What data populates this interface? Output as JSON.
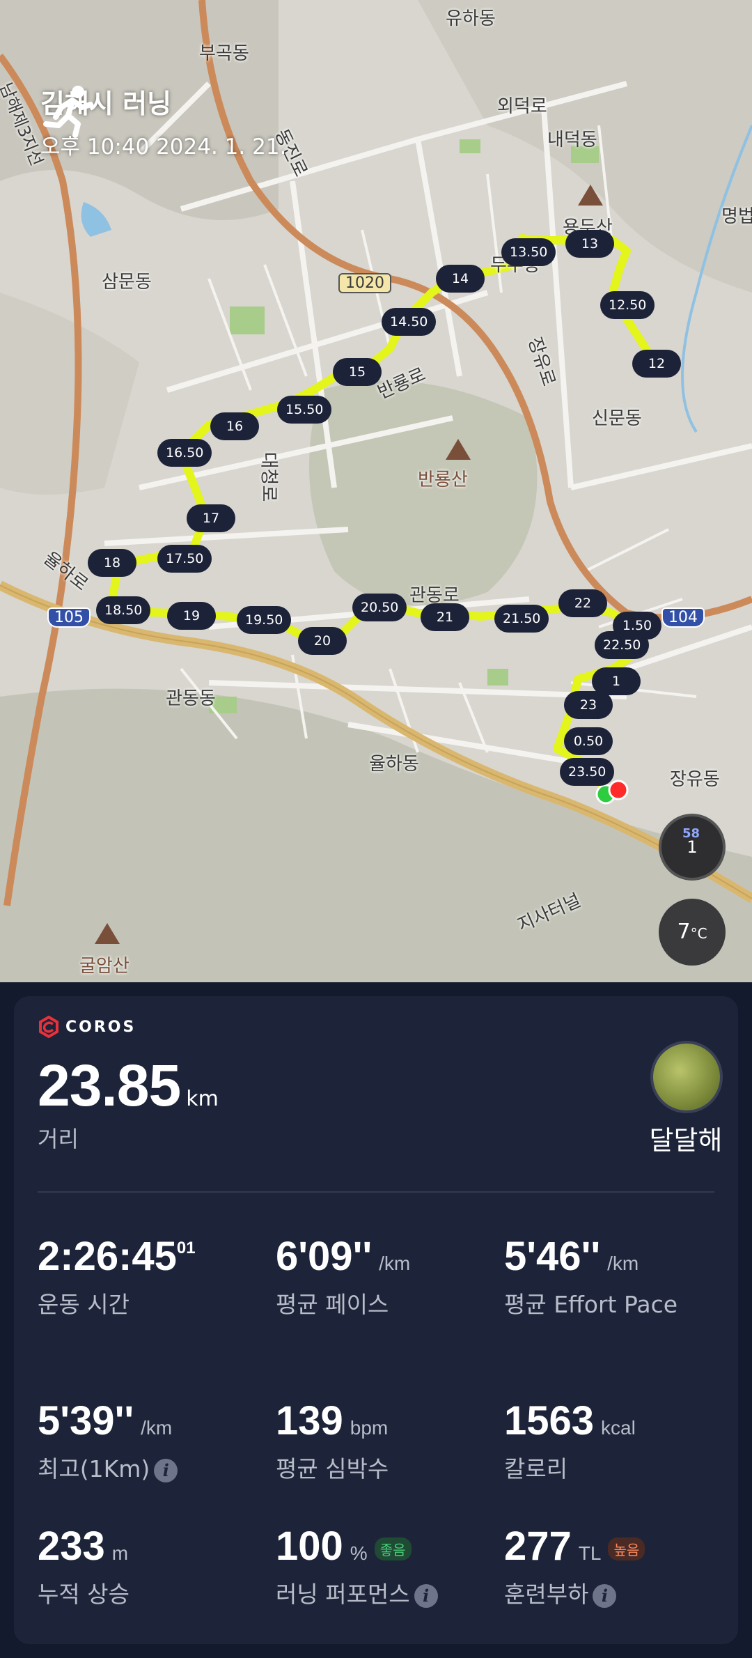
{
  "activity": {
    "title": "김해시 러닝",
    "datetime": "오후 10:40 2024. 1. 21."
  },
  "map": {
    "place_labels": [
      "유하동",
      "부곡동",
      "외덕로",
      "내덕동",
      "용두산",
      "명법",
      "삼문동",
      "1020",
      "두무동",
      "장유로",
      "반룡로",
      "신문동",
      "반룡산",
      "대청로",
      "율하로",
      "105",
      "관동로",
      "104",
      "관동동",
      "율하동",
      "장유동",
      "지사터널",
      "굴암산",
      "남해제3지선",
      "동진로"
    ],
    "km_markers": [
      "0.50",
      "1",
      "1.50",
      "12",
      "12.50",
      "13",
      "13.50",
      "14",
      "14.50",
      "15",
      "15.50",
      "16",
      "16.50",
      "17",
      "17.50",
      "18",
      "18.50",
      "19",
      "19.50",
      "20",
      "20.50",
      "21",
      "21.50",
      "22",
      "22.50",
      "23",
      "23.50"
    ],
    "route_color": "#e3f51a",
    "compass_value": "1",
    "compass_badge": "58",
    "temperature": "7",
    "temperature_unit": "°C"
  },
  "summary": {
    "brand": "COROS",
    "distance_value": "23.85",
    "distance_unit": "km",
    "distance_label": "거리",
    "user_name": "달달해"
  },
  "stats": [
    {
      "value": "2:26:45",
      "sup": "01",
      "unit": "",
      "label": "운동 시간"
    },
    {
      "value": "6'09''",
      "unit": "/km",
      "label": "평균 페이스"
    },
    {
      "value": "5'46''",
      "unit": "/km",
      "label": "평균 Effort Pace"
    },
    {
      "value": "5'39''",
      "unit": "/km",
      "label": "최고(1Km)"
    },
    {
      "value": "139",
      "unit": "bpm",
      "label": "평균 심박수"
    },
    {
      "value": "1563",
      "unit": "kcal",
      "label": "칼로리"
    },
    {
      "value": "233",
      "unit": "m",
      "label": "누적 상승"
    },
    {
      "value": "100",
      "unit": "%",
      "tag": "좋음",
      "label": "러닝 퍼포먼스"
    },
    {
      "value": "277",
      "unit": "TL",
      "tag": "높음",
      "label": "훈련부하"
    }
  ]
}
